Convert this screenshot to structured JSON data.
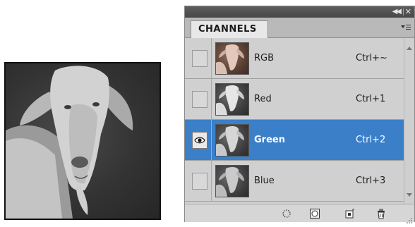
{
  "panel": {
    "tab_label": "CHANNELS",
    "titlebar_icons": [
      "collapse-icon",
      "close-icon"
    ],
    "menu_icon": "panel-menu-icon"
  },
  "channels": [
    {
      "name": "RGB",
      "shortcut": "Ctrl+~",
      "visible": false,
      "selected": false,
      "thumb": "color"
    },
    {
      "name": "Red",
      "shortcut": "Ctrl+1",
      "visible": false,
      "selected": false,
      "thumb": "gray"
    },
    {
      "name": "Green",
      "shortcut": "Ctrl+2",
      "visible": true,
      "selected": true,
      "thumb": "gray"
    },
    {
      "name": "Blue",
      "shortcut": "Ctrl+3",
      "visible": false,
      "selected": false,
      "thumb": "gray"
    }
  ],
  "bottom_buttons": [
    "load-channel-as-selection-icon",
    "save-selection-as-channel-icon",
    "new-channel-icon",
    "delete-channel-icon"
  ],
  "colors": {
    "selected_row": "#3b7fc8",
    "panel_bg": "#d6d6d6",
    "titlebar": "#4f4f4f"
  }
}
